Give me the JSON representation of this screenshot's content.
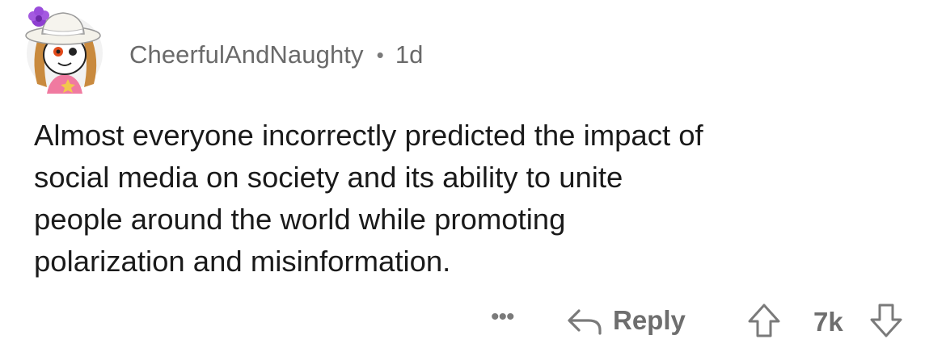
{
  "comment": {
    "username": "CheerfulAndNaughty",
    "separator": "•",
    "age": "1d",
    "body_lines": [
      "Almost everyone incorrectly predicted the impact of",
      "social media on society and its ability to unite",
      "people around the world while promoting",
      "polarization and misinformation."
    ]
  },
  "actions": {
    "more_label": "•••",
    "reply_label": "Reply",
    "vote_count": "7k"
  },
  "icons": {
    "avatar": "avatar-icon",
    "reply": "reply-arrow-icon",
    "upvote": "upvote-arrow-icon",
    "downvote": "downvote-arrow-icon",
    "more": "more-options-icon"
  }
}
